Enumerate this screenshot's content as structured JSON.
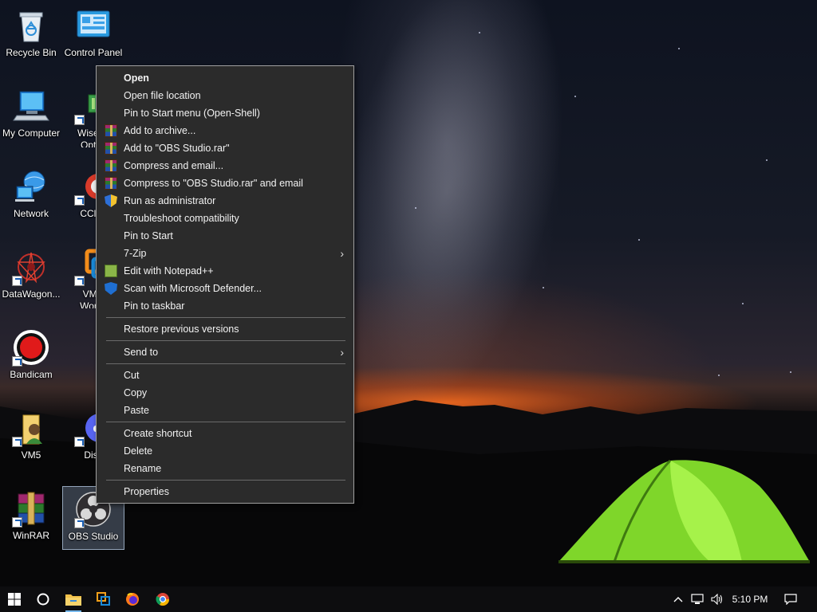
{
  "desktop": {
    "icons": [
      {
        "label": "Recycle Bin",
        "icon": "recycle-bin-icon"
      },
      {
        "label": "Control Panel",
        "icon": "control-panel-icon"
      },
      {
        "label": "My Computer",
        "icon": "computer-icon"
      },
      {
        "label": "Wise Memory Optimizer",
        "label_line1": "Wise M",
        "label_line2": "Optim",
        "icon": "wise-memory-optimizer-icon"
      },
      {
        "label": "Network",
        "icon": "network-icon"
      },
      {
        "label": "CCleaner",
        "label_visible": "CClea",
        "icon": "ccleaner-icon"
      },
      {
        "label": "DataWagon...",
        "icon": "datawagon-icon"
      },
      {
        "label_line1": "VMw",
        "label_line2": "Works",
        "icon": "vmware-icon"
      },
      {
        "label": "Bandicam",
        "icon": "bandicam-icon"
      },
      {
        "label": "VM5",
        "icon": "vm5-folder-icon"
      },
      {
        "label_visible": "Disc",
        "icon": "discord-icon"
      },
      {
        "label": "WinRAR",
        "icon": "winrar-icon"
      },
      {
        "label": "OBS Studio",
        "icon": "obs-studio-icon",
        "selected": true
      }
    ]
  },
  "context_menu": {
    "items": [
      {
        "label": "Open",
        "bold": true
      },
      {
        "label": "Open file location"
      },
      {
        "label": "Pin to Start menu (Open-Shell)"
      },
      {
        "label": "Add to archive...",
        "icon": "winrar-icon"
      },
      {
        "label": "Add to \"OBS Studio.rar\"",
        "icon": "winrar-icon"
      },
      {
        "label": "Compress and email...",
        "icon": "winrar-icon"
      },
      {
        "label": "Compress to \"OBS Studio.rar\" and email",
        "icon": "winrar-icon"
      },
      {
        "label": "Run as administrator",
        "icon": "uac-shield-icon"
      },
      {
        "label": "Troubleshoot compatibility"
      },
      {
        "label": "Pin to Start"
      },
      {
        "label": "7-Zip",
        "submenu": true
      },
      {
        "label": "Edit with Notepad++",
        "icon": "notepad-plus-plus-icon"
      },
      {
        "label": "Scan with Microsoft Defender...",
        "icon": "defender-icon"
      },
      {
        "label": "Pin to taskbar"
      },
      {
        "label": "Restore previous versions"
      },
      {
        "label": "Send to",
        "submenu": true
      },
      {
        "label": "Cut"
      },
      {
        "label": "Copy"
      },
      {
        "label": "Paste"
      },
      {
        "label": "Create shortcut"
      },
      {
        "label": "Delete"
      },
      {
        "label": "Rename"
      },
      {
        "label": "Properties"
      }
    ],
    "submenu_arrow": "›"
  },
  "taskbar": {
    "clock": "5:10 PM",
    "pinned": [
      "windows-start-icon",
      "cortana-search-icon",
      "file-explorer-icon",
      "task-view-app-icon",
      "firefox-icon",
      "chrome-icon"
    ],
    "tray": [
      "show-hidden-icons-chevron",
      "network-tray-icon",
      "volume-icon"
    ]
  },
  "colors": {
    "menu_bg": "#2b2b2b",
    "menu_text": "#f2f2f2",
    "taskbar_bg": "#0d0d0f",
    "accent": "#76b9ed"
  }
}
